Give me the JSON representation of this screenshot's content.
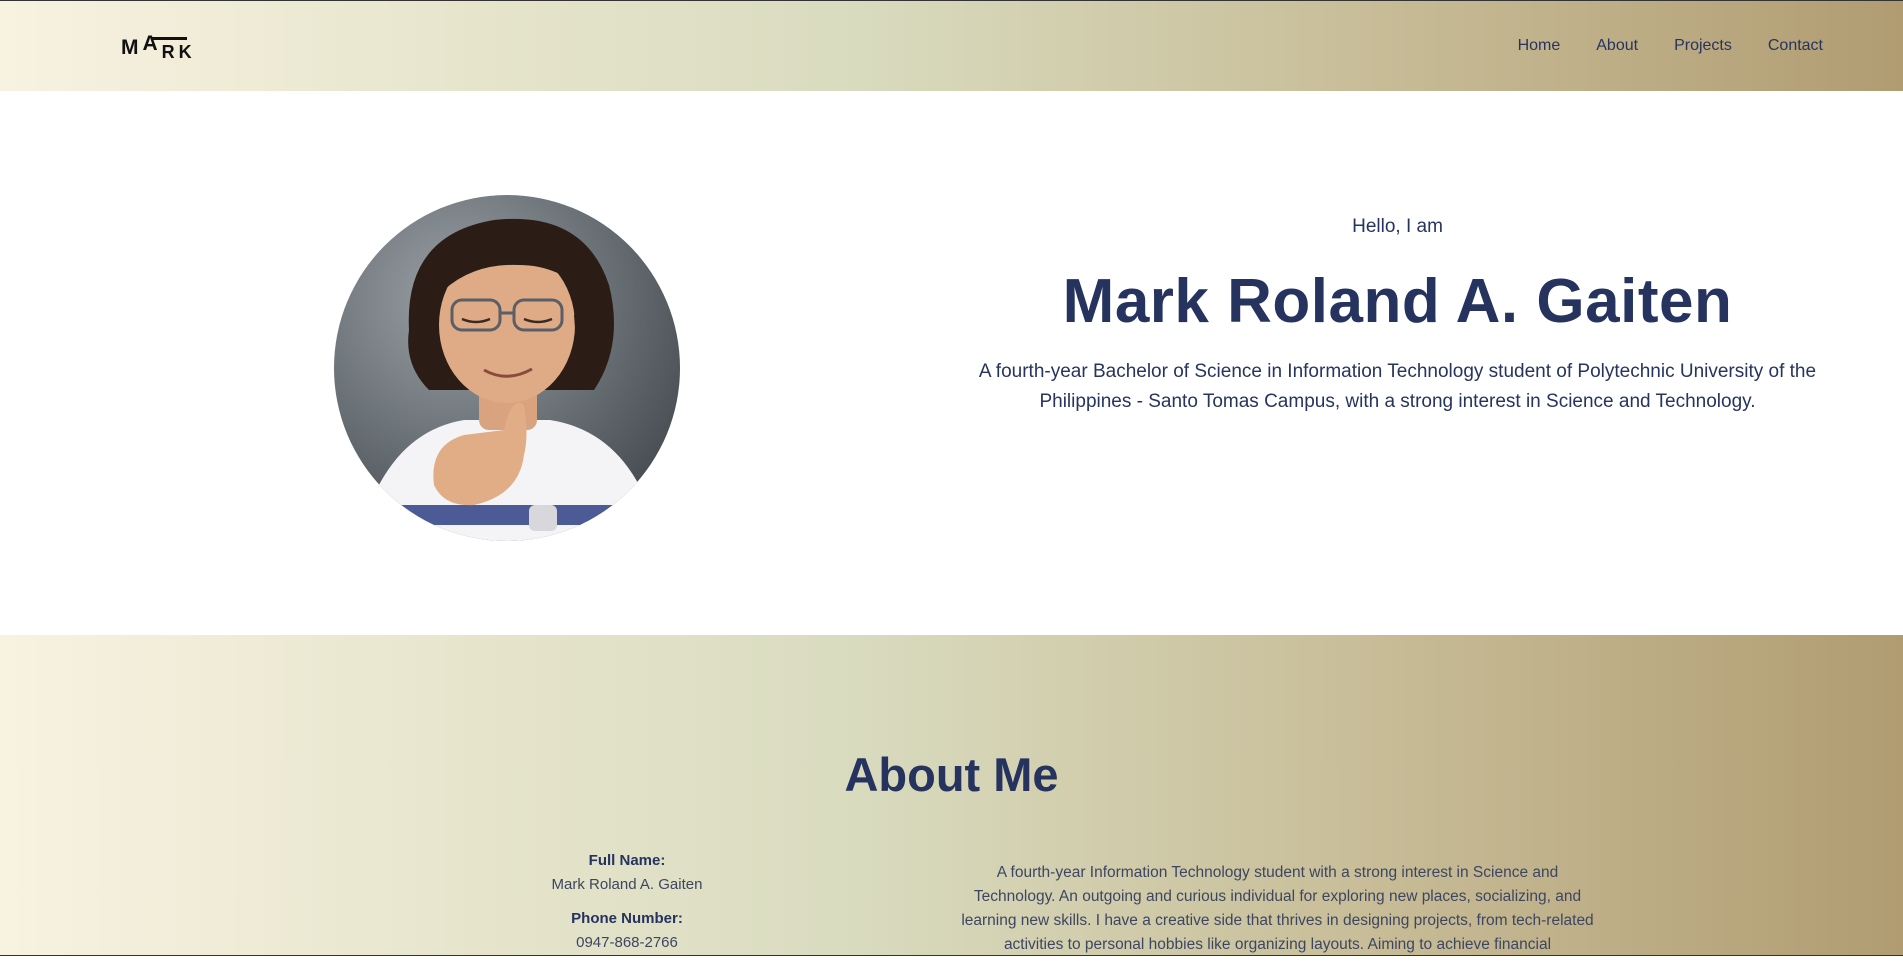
{
  "header": {
    "logo_letters": [
      "M",
      "A",
      "R",
      "K"
    ],
    "nav": [
      "Home",
      "About",
      "Projects",
      "Contact"
    ]
  },
  "hero": {
    "greeting": "Hello, I am",
    "name": "Mark Roland A. Gaiten",
    "intro": "A fourth-year Bachelor of Science in Information Technology student of Polytechnic University of the Philippines - Santo Tomas Campus, with a strong interest in Science and Technology."
  },
  "about": {
    "title": "About Me",
    "details": [
      {
        "label": "Full Name:",
        "value": "Mark Roland A. Gaiten"
      },
      {
        "label": "Phone Number:",
        "value": "0947-868-2766"
      }
    ],
    "bio": "A fourth-year Information Technology student with a strong interest in Science and Technology. An outgoing and curious individual for exploring new places, socializing, and learning new skills. I have a creative side that thrives in designing projects, from tech-related activities to personal hobbies like organizing layouts. Aiming to achieve financial"
  },
  "colors": {
    "navy": "#25335e",
    "gradient_start": "#f8f2e1",
    "gradient_end": "#b19c72"
  }
}
